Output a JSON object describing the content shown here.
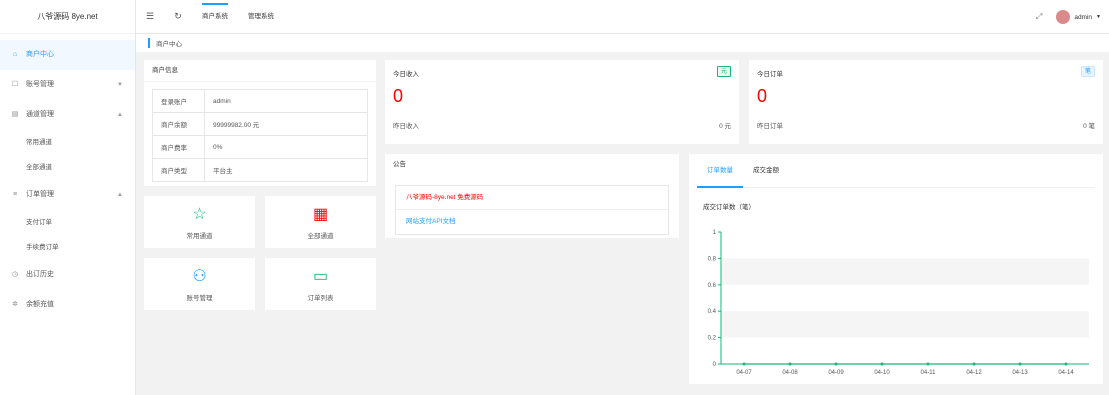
{
  "app": {
    "title": "八爷源码 8ye.net"
  },
  "sidebar": {
    "items": [
      {
        "label": "商户中心",
        "icon": "home-icon"
      },
      {
        "label": "账号管理",
        "icon": "user-icon"
      },
      {
        "label": "通道管理",
        "icon": "list-icon"
      },
      {
        "label": "常用通道",
        "sub": true
      },
      {
        "label": "全部通道",
        "sub": true
      },
      {
        "label": "订单管理",
        "icon": "menu-icon"
      },
      {
        "label": "支付订单",
        "sub": true
      },
      {
        "label": "手续费订单",
        "sub": true
      },
      {
        "label": "出订历史",
        "icon": "clock-icon"
      },
      {
        "label": "余额充值",
        "icon": "gear-icon"
      }
    ]
  },
  "topbar": {
    "links": [
      "商户系统",
      "管理系统"
    ],
    "user": "admin"
  },
  "breadcrumb": "商户中心",
  "account": {
    "title": "商户信息",
    "rows": [
      {
        "k": "登录账户",
        "v": "admin"
      },
      {
        "k": "商户余额",
        "v": "99999982.00 元"
      },
      {
        "k": "商户费率",
        "v": "0%"
      },
      {
        "k": "商户类型",
        "v": "平台主"
      }
    ]
  },
  "quick": [
    {
      "label": "常用通道",
      "icon": "star-icon"
    },
    {
      "label": "全部通道",
      "icon": "grid-icon"
    },
    {
      "label": "账号管理",
      "icon": "users-icon"
    },
    {
      "label": "订单列表",
      "icon": "file-icon"
    }
  ],
  "income": {
    "title": "今日收入",
    "tag": "元",
    "tag_color": "#16b777",
    "value": "0",
    "left": "昨日收入",
    "right": "0 元"
  },
  "orders": {
    "title": "今日订单",
    "tag": "笔",
    "tag_color": "#1e9fff",
    "value": "0",
    "left": "昨日订单",
    "right": "0 笔"
  },
  "notice": {
    "title": "公告",
    "items": [
      {
        "text": "八爷源码-8ye.net 免费源码",
        "color": "#f00"
      },
      {
        "text": "网站支付API文档",
        "color": "#1e9fff"
      }
    ]
  },
  "chart_panel": {
    "tabs": [
      "订单数量",
      "成交金额"
    ],
    "subtitle": "成交订单数（笔）"
  },
  "chart_data": {
    "type": "line",
    "x": [
      "04-07",
      "04-08",
      "04-09",
      "04-10",
      "04-11",
      "04-12",
      "04-13",
      "04-14"
    ],
    "series": [
      {
        "values": [
          0,
          0,
          0,
          0,
          0,
          0,
          0,
          0
        ],
        "color": "#16b777"
      }
    ],
    "ylim": [
      0,
      1
    ],
    "yticks": [
      "0",
      "0.2",
      "0.4",
      "0.6",
      "0.8",
      "1"
    ]
  }
}
